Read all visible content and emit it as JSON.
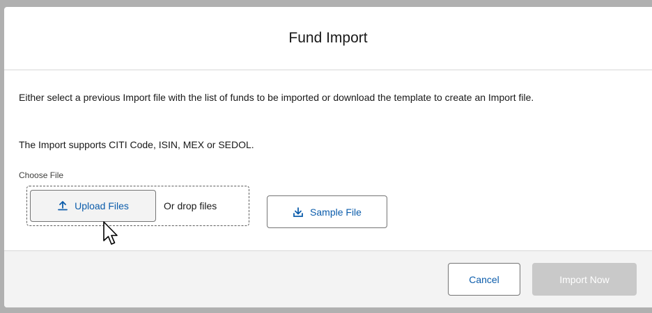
{
  "dialog": {
    "title": "Fund Import",
    "description": "Either select a previous Import file with the list of funds to be imported or download the template to create an Import file.",
    "supports": "The Import supports CITI Code, ISIN, MEX or SEDOL."
  },
  "file_upload": {
    "label": "Choose File",
    "upload_button": "Upload Files",
    "drop_text": "Or drop files",
    "upload_icon": "upload-icon",
    "sample_button": "Sample File",
    "sample_icon": "download-icon"
  },
  "footer": {
    "cancel": "Cancel",
    "import": "Import Now",
    "import_disabled": true
  },
  "colors": {
    "link": "#0b5cab",
    "disabled_button": "#c9c9c9"
  }
}
